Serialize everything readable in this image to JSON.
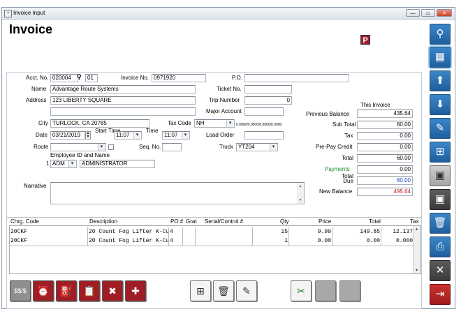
{
  "window": {
    "title": "Invoice Input",
    "app_icon": "app-icon"
  },
  "page": {
    "heading": "Invoice",
    "badge": "P",
    "badge_color": "#a01c2c"
  },
  "form": {
    "acct_no_label": "Acct. No.",
    "acct_no": "020004",
    "acct_suffix": "01",
    "invoice_no_label": "Invoice No.",
    "invoice_no": "0971920",
    "po_label": "P.O.",
    "po": "",
    "name_label": "Name",
    "name": "Advantage Route Systems",
    "ticket_no_label": "Ticket No.",
    "ticket_no": "",
    "address_label": "Address",
    "address": "123 LIBERTY SQUARE",
    "address2": "",
    "trip_number_label": "Trip Number",
    "trip_number": "0",
    "major_account_label": "Major Account",
    "major_account": "",
    "city_label": "City",
    "city": "TURLOCK, CA 20785",
    "tax_code_label": "Tax Code",
    "tax_code": "NH",
    "tax_rates": "0.0000/0.0000/0.0000/0.0000",
    "date_label": "Date",
    "date": "03/21/2019",
    "start_time_label": "Start Time",
    "start_time": "11:07",
    "time_label": "Time",
    "time": "11:07",
    "load_order_label": "Load Order",
    "load_order": "",
    "route_label": "Route",
    "route": "",
    "seq_no_label": "Seq. No.",
    "seq_no": "",
    "truck_label": "Truck",
    "truck": "YT204",
    "employee_label": "Employee ID and Name",
    "employee_row_no": "1",
    "employee_id": "ADM",
    "employee_name": "ADMINISTRATOR",
    "narrative_label": "Narrative",
    "narrative": ""
  },
  "totals": {
    "this_invoice_label": "This Invoice",
    "previous_balance_label": "Previous Balance",
    "previous_balance": "435.64",
    "sub_total_label": "Sub Total",
    "sub_total": "60.00",
    "tax_label": "Tax",
    "tax": "0.00",
    "prepay_credit_label": "Pre-Pay Credit",
    "prepay_credit": "0.00",
    "total_label": "Total",
    "total": "60.00",
    "payments_label": "Payments",
    "payments": "0.00",
    "total_due_label1": "Total",
    "total_due_label2": "Due",
    "total_due": "60.00",
    "new_balance_label": "New Balance",
    "new_balance": "495.64",
    "payments_color": "#1a8a2a",
    "total_due_color": "#1d3fbf",
    "new_balance_color": "#c0202a"
  },
  "grid": {
    "headers": [
      "Chrg. Code",
      "Description",
      "PO #",
      "Grat",
      "Serial/Control #",
      "Qty",
      "Price",
      "Total",
      "Tax"
    ],
    "rows": [
      {
        "code": "20CKF",
        "description": "20 Count Fog Lifter K-Cup",
        "po": "4",
        "grat": "",
        "serial": "",
        "qty": "15",
        "price": "9.99",
        "total": "149.85",
        "tax": "12.137"
      },
      {
        "code": "20CKF",
        "description": "20 Count Fog Lifter K-Cup",
        "po": "4",
        "grat": "",
        "serial": "",
        "qty": "1",
        "price": "0.00",
        "total": "0.00",
        "tax": "0.000"
      }
    ]
  },
  "bottom_buttons": {
    "left": [
      "price-tag-icon",
      "alarm-clock-icon",
      "tanks-icon",
      "clipboard-icon",
      "tools-icon",
      "plug-add-icon"
    ],
    "middle": [
      "add-document-icon",
      "delete-icon",
      "edit-icon"
    ],
    "right": [
      "scissors-money-icon",
      "blank-icon",
      "blank-icon"
    ]
  },
  "sidebar_buttons": [
    "search-icon",
    "grid-icon",
    "arrow-up-icon",
    "arrow-down-icon",
    "pencil-icon",
    "add-page-icon",
    "save-add-icon",
    "save-icon",
    "trash-icon",
    "print-icon",
    "close-icon",
    "exit-icon"
  ]
}
